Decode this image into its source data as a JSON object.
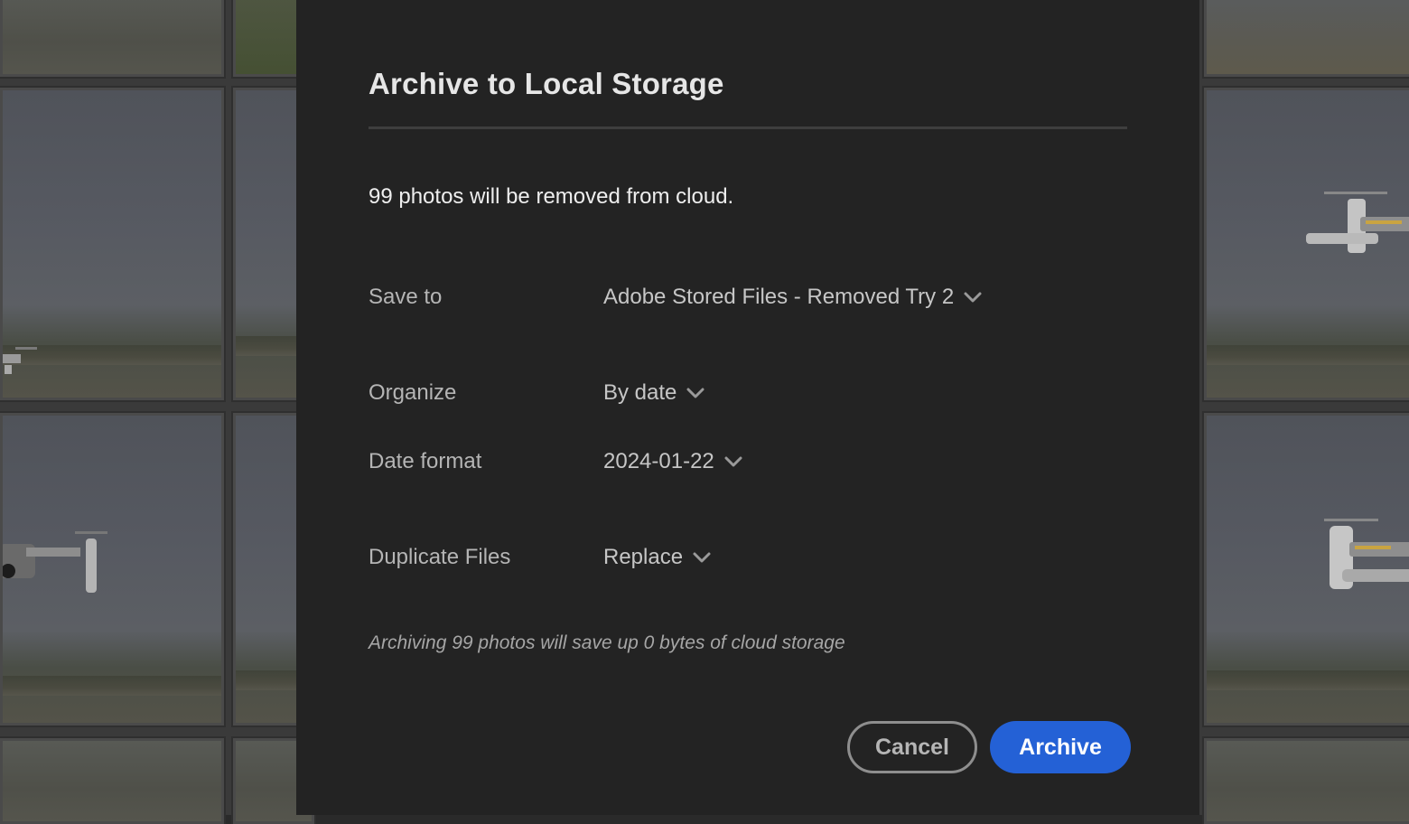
{
  "dialog": {
    "title": "Archive to Local Storage",
    "summary": "99 photos will be removed from cloud.",
    "fields": [
      {
        "label": "Save to",
        "value": "Adobe Stored Files - Removed Try 2",
        "icon": "chevron-down-icon"
      },
      {
        "label": "Organize",
        "value": "By date",
        "icon": "chevron-down-icon"
      },
      {
        "label": "Date format",
        "value": "2024-01-22",
        "icon": "chevron-down-icon"
      },
      {
        "label": "Duplicate Files",
        "value": "Replace",
        "icon": "chevron-down-icon"
      }
    ],
    "note": "Archiving 99 photos will save up 0 bytes of cloud storage",
    "buttons": {
      "cancel": "Cancel",
      "archive": "Archive"
    }
  },
  "colors": {
    "modal_bg": "#232323",
    "primary_button": "#2461d6",
    "overlay_bg": "#2a2a2a"
  }
}
